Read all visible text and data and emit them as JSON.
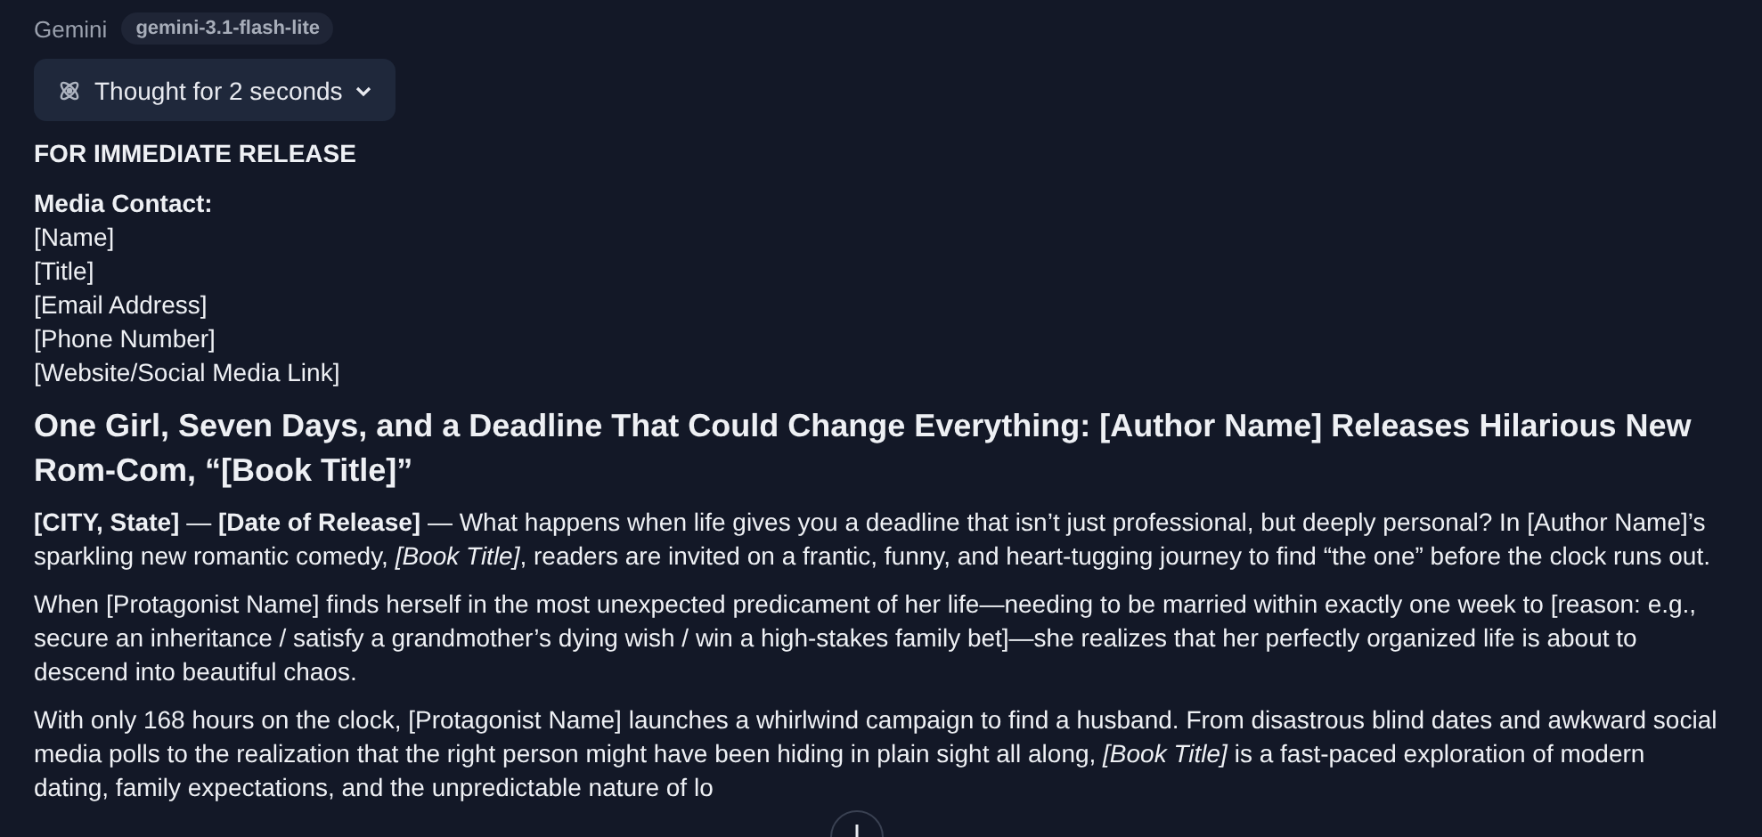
{
  "header": {
    "assistant": "Gemini",
    "model": "gemini-3.1-flash-lite"
  },
  "thought": {
    "label": "Thought for 2 seconds",
    "expanded": false
  },
  "release_line": "FOR IMMEDIATE RELEASE",
  "contact": {
    "heading": "Media Contact:",
    "lines": [
      "[Name]",
      "[Title]",
      "[Email Address]",
      "[Phone Number]",
      "[Website/Social Media Link]"
    ]
  },
  "headline": "One Girl, Seven Days, and a Deadline That Could Change Everything: [Author Name] Releases Hilarious New Rom-Com, “[Book Title]”",
  "paragraphs": [
    "**[CITY, State]** — **[Date of Release]** — What happens when life gives you a deadline that isn’t just professional, but deeply personal? In [Author Name]’s sparkling new romantic comedy, *[Book Title]*, readers are invited on a frantic, funny, and heart-tugging journey to find “the one” before the clock runs out.",
    "When [Protagonist Name] finds herself in the most unexpected predicament of her life—needing to be married within exactly one week to [reason: e.g., secure an inheritance / satisfy a grandmother’s dying wish / win a high-stakes family bet]—she realizes that her perfectly organized life is about to descend into beautiful chaos.",
    "With only 168 hours on the clock, [Protagonist Name] launches a whirlwind campaign to find a husband. From disastrous blind dates and awkward social media polls to the realization that the right person might have been hiding in plain sight all along, *[Book Title]* is a fast-paced exploration of modern dating, family expectations, and the unpredictable nature of lo"
  ]
}
